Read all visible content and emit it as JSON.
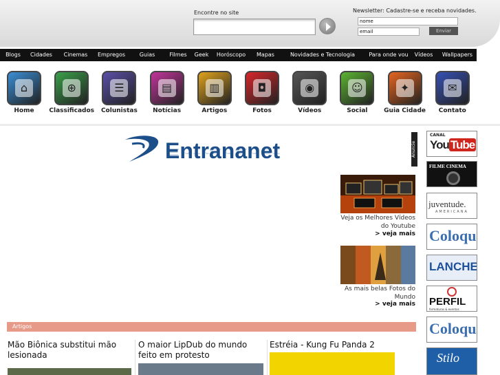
{
  "header": {
    "search_label": "Encontre no site",
    "newsletter_label": "Newsletter: Cadastre-se e receba novidades.",
    "newsletter_name_value": "nome",
    "newsletter_email_value": "email",
    "newsletter_submit": "Enviar"
  },
  "nav": [
    "Blogs",
    "Cidades",
    "Cinemas",
    "Empregos",
    "Guias",
    "Filmes",
    "Geek",
    "Horóscopo",
    "Mapas",
    "Novidades e Tecnologia",
    "Para onde vou",
    "Vídeos",
    "Wallpapers"
  ],
  "icons": [
    {
      "label": "Home",
      "icon": "home-icon",
      "color": "#3a8ed6"
    },
    {
      "label": "Classificados",
      "icon": "magnifier-icon",
      "color": "#3aa04a"
    },
    {
      "label": "Colunistas",
      "icon": "chat-icon",
      "color": "#5a4fa8"
    },
    {
      "label": "Notícias",
      "icon": "newspaper-icon",
      "color": "#c2349a"
    },
    {
      "label": "Artigos",
      "icon": "document-icon",
      "color": "#e0a21c"
    },
    {
      "label": "Fotos",
      "icon": "photo-icon",
      "color": "#d8262a"
    },
    {
      "label": "Vídeos",
      "icon": "film-icon",
      "color": "#555555"
    },
    {
      "label": "Social",
      "icon": "people-icon",
      "color": "#5cb431"
    },
    {
      "label": "Guia Cidade",
      "icon": "map-icon",
      "color": "#e6651f"
    },
    {
      "label": "Contato",
      "icon": "envelope-icon",
      "color": "#3650b4"
    }
  ],
  "logo_text": "Entrananet",
  "anuncie_label": "Anuncie",
  "promos": [
    {
      "text": "Veja os Melhores Vídeos do Youtube",
      "more": "> veja mais"
    },
    {
      "text": "As mais belas Fotos do Mundo",
      "more": "> veja mais"
    }
  ],
  "ads": [
    {
      "line1": "CANAL",
      "line2": "You Tube"
    },
    {
      "line1": "FILME CINEMA"
    },
    {
      "line1": "juventude.",
      "line2": "AMERICANA"
    },
    {
      "line1": "Coloque"
    },
    {
      "line1": "LANCHE"
    },
    {
      "line1": "PERFIL",
      "line2": "formaturas & eventos"
    },
    {
      "line1": "Coloque"
    },
    {
      "line1": "Stilo"
    }
  ],
  "section_label": "Artigos",
  "articles": [
    {
      "title": "Mão Biônica substitui mão lesionada"
    },
    {
      "title": "O maior LipDub do mundo feito em protesto"
    },
    {
      "title": "Estréia - Kung Fu Panda 2"
    }
  ],
  "colors": {
    "nav_bg": "#111111",
    "section_bar": "#e89a88",
    "logo_blue": "#1c4f8a"
  }
}
